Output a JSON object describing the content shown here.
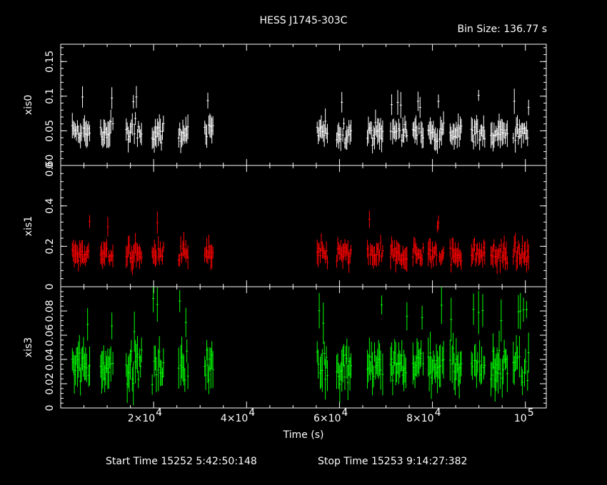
{
  "chart_data": {
    "type": "line",
    "title": "HESS J1745-303C",
    "bin_size_label": "Bin Size:  136.77  s",
    "xlabel": "Time (s)",
    "start_time_label": "Start Time 15252   5:42:50:148",
    "stop_time_label": "Stop Time 15253   9:14:27:382",
    "xlim": [
      0,
      104500
    ],
    "x_ticks": [
      {
        "value": 20000,
        "label": "2×10",
        "exp": "4"
      },
      {
        "value": 40000,
        "label": "4×10",
        "exp": "4"
      },
      {
        "value": 60000,
        "label": "6×10",
        "exp": "4"
      },
      {
        "value": 80000,
        "label": "8×10",
        "exp": "4"
      },
      {
        "value": 100000,
        "label": "10",
        "exp": "5"
      }
    ],
    "segments": [
      [
        2500,
        6300
      ],
      [
        8600,
        11400
      ],
      [
        14100,
        17500
      ],
      [
        19700,
        22200
      ],
      [
        25400,
        27400
      ],
      [
        31000,
        32800
      ],
      [
        55200,
        57400
      ],
      [
        59400,
        62600
      ],
      [
        66000,
        69400
      ],
      [
        71000,
        74600
      ],
      [
        75800,
        78200
      ],
      [
        79100,
        82400
      ],
      [
        83800,
        86400
      ],
      [
        88400,
        91300
      ],
      [
        92600,
        96200
      ],
      [
        97400,
        100800
      ]
    ],
    "panels": [
      {
        "name": "xis0",
        "ylabel": "xis0",
        "color": "#ffffff",
        "ylim": [
          0,
          0.175
        ],
        "yticks": [
          0,
          0.05,
          0.1,
          0.15
        ],
        "ytick_labels": [
          "0",
          "0.05",
          "0.1",
          "0.15"
        ],
        "mean": 0.048,
        "spread": 0.022
      },
      {
        "name": "xis1",
        "ylabel": "xis1",
        "color": "#ff0000",
        "ylim": [
          0,
          0.6
        ],
        "yticks": [
          0,
          0.2,
          0.4,
          0.6
        ],
        "ytick_labels": [
          "0",
          "0.2",
          "0.4",
          "0.60"
        ],
        "mean": 0.16,
        "spread": 0.07
      },
      {
        "name": "xis3",
        "ylabel": "xis3",
        "color": "#00ff00",
        "ylim": [
          0,
          0.1
        ],
        "yticks": [
          0,
          0.02,
          0.04,
          0.06,
          0.08
        ],
        "ytick_labels": [
          "0",
          "0.02",
          "0.04",
          "0.06",
          "0.08"
        ],
        "mean": 0.035,
        "spread": 0.02
      }
    ]
  }
}
